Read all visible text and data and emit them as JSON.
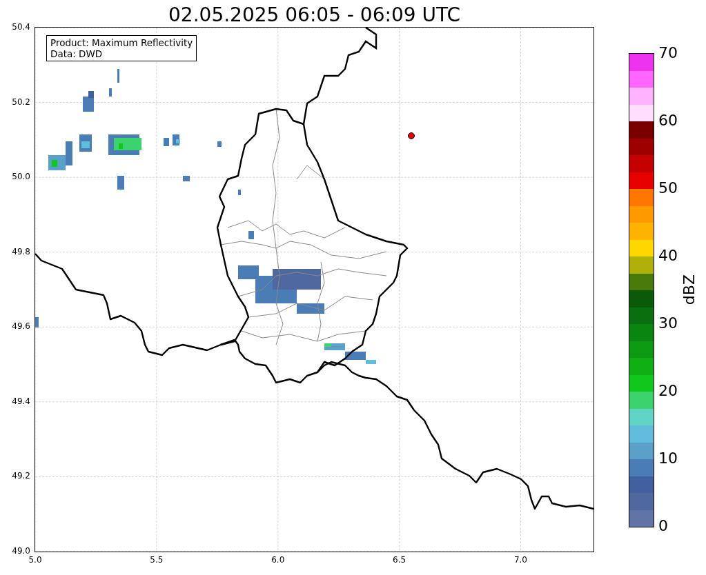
{
  "title": "02.05.2025 06:05 - 06:09 UTC",
  "info_box": [
    "Product: Maximum Reflectivity",
    "Data: DWD"
  ],
  "y_ticks": [
    "50.4",
    "50.2",
    "50.0",
    "49.8",
    "49.6",
    "49.4",
    "49.2",
    "49.0"
  ],
  "x_ticks": [
    "5.0",
    "5.5",
    "6.0",
    "6.5",
    "7.0"
  ],
  "colorbar": {
    "label": "dBZ",
    "ticks": [
      "70",
      "60",
      "50",
      "40",
      "30",
      "20",
      "10",
      "0"
    ],
    "bins": [
      {
        "color": "#ee33ee"
      },
      {
        "color": "#ff66ff"
      },
      {
        "color": "#ffb3ff"
      },
      {
        "color": "#ffddff"
      },
      {
        "color": "#7a0000"
      },
      {
        "color": "#9e0000"
      },
      {
        "color": "#c40000"
      },
      {
        "color": "#e60000"
      },
      {
        "color": "#ff7700"
      },
      {
        "color": "#ff9900"
      },
      {
        "color": "#ffb300"
      },
      {
        "color": "#ffd700"
      },
      {
        "color": "#b0b00a"
      },
      {
        "color": "#4a7a0a"
      },
      {
        "color": "#0a5a0a"
      },
      {
        "color": "#0a700f"
      },
      {
        "color": "#0a8510"
      },
      {
        "color": "#0c9a12"
      },
      {
        "color": "#0eb014"
      },
      {
        "color": "#10c81c"
      },
      {
        "color": "#3cd26e"
      },
      {
        "color": "#60d5c5"
      },
      {
        "color": "#62bcdc"
      },
      {
        "color": "#5aa0c8"
      },
      {
        "color": "#4a7cb6"
      },
      {
        "color": "#4060a0"
      },
      {
        "color": "#5068a0"
      },
      {
        "color": "#6074a8"
      }
    ]
  }
}
